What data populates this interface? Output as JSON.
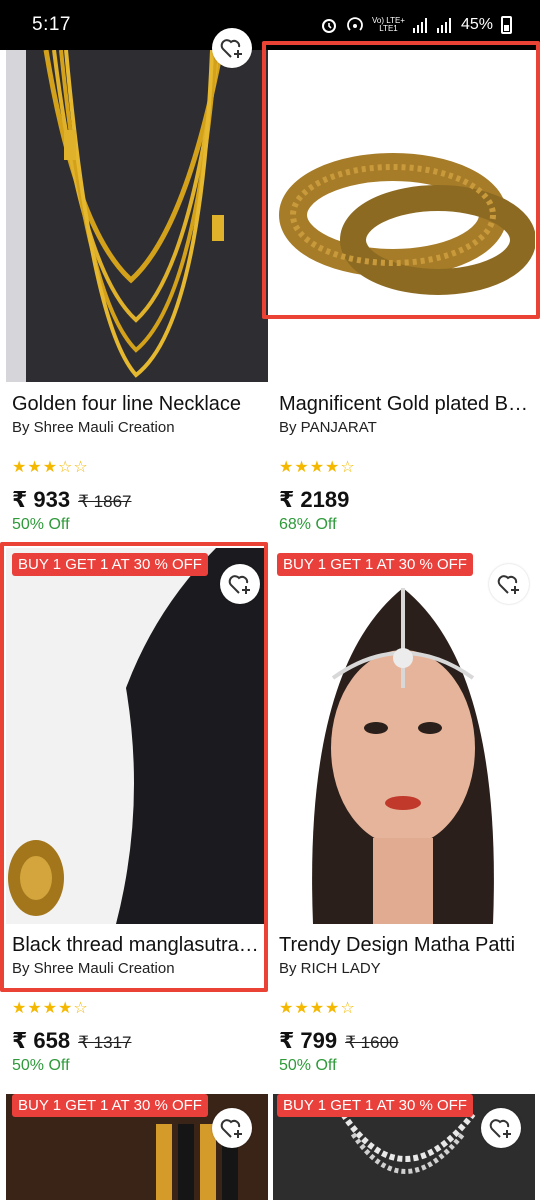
{
  "status_bar": {
    "time": "5:17",
    "network_top": "Vo) LTE+",
    "network_bottom": "LTE1",
    "battery": "45%"
  },
  "products": [
    {
      "title": "Golden four line Necklace",
      "brand": "By Shree Mauli Creation",
      "rating": 3,
      "price": "₹ 933",
      "old_price": "₹ 1867",
      "discount": "50% Off",
      "badge": ""
    },
    {
      "title": "Magnificent Gold plated Bangles",
      "brand": "By PANJARAT",
      "rating": 4,
      "price": "₹ 2189",
      "old_price": "",
      "discount": "68% Off",
      "badge": ""
    },
    {
      "title": "Black thread manglasutra pendant",
      "brand": "By Shree Mauli Creation",
      "rating": 4,
      "price": "₹ 658",
      "old_price": "₹ 1317",
      "discount": "50% Off",
      "badge": "BUY 1 GET 1 AT 30 % OFF"
    },
    {
      "title": "Trendy Design Matha Patti",
      "brand": "By RICH LADY",
      "rating": 4,
      "price": "₹ 799",
      "old_price": "₹ 1600",
      "discount": "50% Off",
      "badge": "BUY 1 GET 1 AT 30 % OFF"
    },
    {
      "badge": "BUY 1 GET 1 AT 30 % OFF"
    },
    {
      "badge": "BUY 1 GET 1 AT 30 % OFF"
    }
  ],
  "colors": {
    "badge": "#e9403b",
    "star": "#f5b800",
    "discount": "#2e9a3a",
    "highlight": "#ea4335"
  },
  "icons": {
    "wishlist": "heart-plus-icon"
  }
}
